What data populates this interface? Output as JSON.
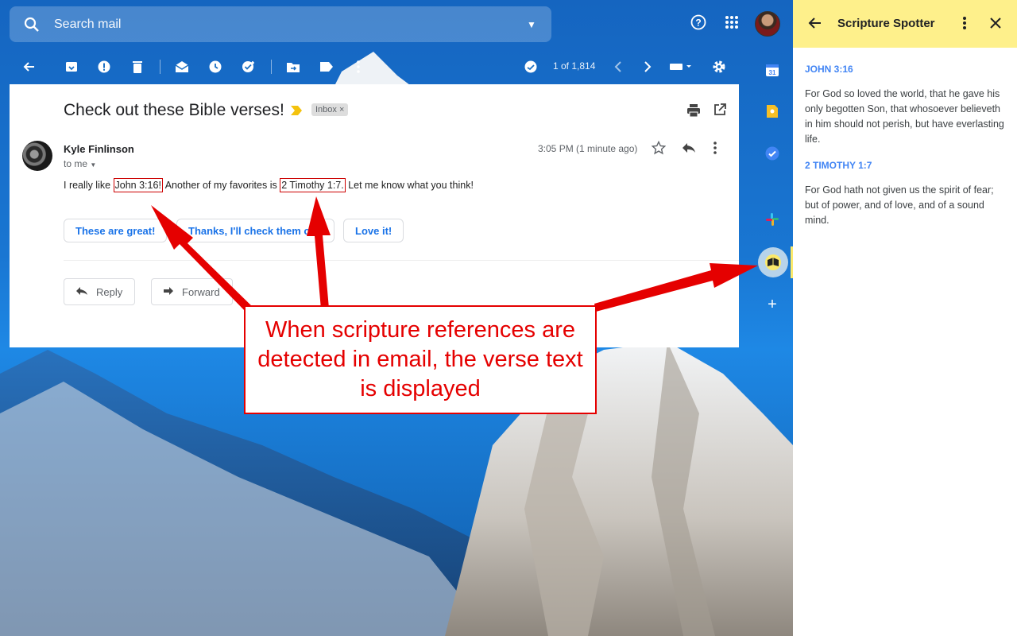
{
  "search": {
    "placeholder": "Search mail"
  },
  "toolbar": {
    "paging": "1 of 1,814"
  },
  "email": {
    "subject": "Check out these Bible verses!",
    "label_chip": "Inbox ×",
    "sender": "Kyle Finlinson",
    "recipient": "to me",
    "time": "3:05 PM (1 minute ago)",
    "body": {
      "part1": "I really like ",
      "ref1": "John 3:16!",
      "part2": " Another of my favorites is ",
      "ref2": "2 Timothy 1:7.",
      "part3": " Let me know what you think!"
    },
    "smart_replies": [
      "These are great!",
      "Thanks, I'll check them out.",
      "Love it!"
    ],
    "actions": {
      "reply": "Reply",
      "forward": "Forward"
    }
  },
  "callout": {
    "text": "When scripture references are detected in email, the verse text is displayed"
  },
  "panel": {
    "title": "Scripture Spotter",
    "verses": [
      {
        "ref": "JOHN 3:16",
        "text": "For God so loved the world, that he gave his only begotten Son, that whosoever believeth in him should not perish, but have everlasting life."
      },
      {
        "ref": "2 TIMOTHY 1:7",
        "text": "For God hath not given us the spirit of fear; but of power, and of love, and of a sound mind."
      }
    ]
  },
  "colors": {
    "accent_blue": "#1a73e8",
    "panel_header": "#fef08b",
    "annotation_red": "#e50000"
  }
}
